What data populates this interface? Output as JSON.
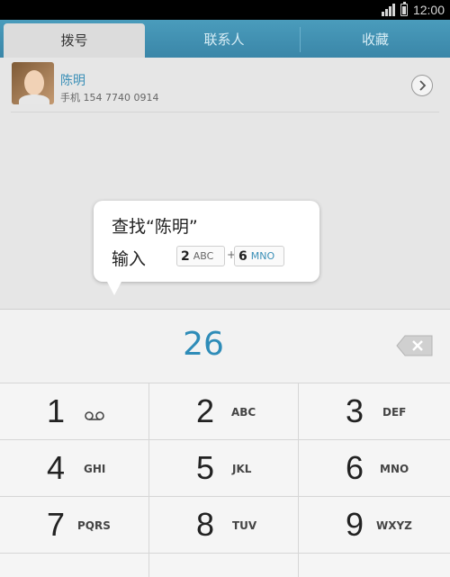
{
  "status_bar": {
    "time": "12:00",
    "signal_icon": "signal-icon",
    "battery_icon": "battery-icon"
  },
  "tabs": [
    {
      "label": "拨号",
      "active": true
    },
    {
      "label": "联系人",
      "active": false
    },
    {
      "label": "收藏",
      "active": false
    }
  ],
  "contact": {
    "name": "陈明",
    "number": "手机 154 7740 0914",
    "arrow_icon": "chevron-right-icon"
  },
  "tooltip": {
    "title": "查找“陈明”",
    "input_label": "输入",
    "keys": [
      {
        "digit": "2",
        "letters": "ABC"
      },
      {
        "digit": "6",
        "letters": "MNO"
      }
    ],
    "plus": "+"
  },
  "dialer": {
    "entered_number": "26",
    "backspace_icon": "backspace-icon",
    "keys": [
      {
        "digit": "1",
        "letters": "",
        "icon": "voicemail-icon"
      },
      {
        "digit": "2",
        "letters": "ABC"
      },
      {
        "digit": "3",
        "letters": "DEF"
      },
      {
        "digit": "4",
        "letters": "GHI"
      },
      {
        "digit": "5",
        "letters": "JKL"
      },
      {
        "digit": "6",
        "letters": "MNO"
      },
      {
        "digit": "7",
        "letters": "PQRS"
      },
      {
        "digit": "8",
        "letters": "TUV"
      },
      {
        "digit": "9",
        "letters": "WXYZ"
      }
    ]
  },
  "colors": {
    "accent": "#2e8cb8",
    "tab_bar": "#3a86a8"
  }
}
